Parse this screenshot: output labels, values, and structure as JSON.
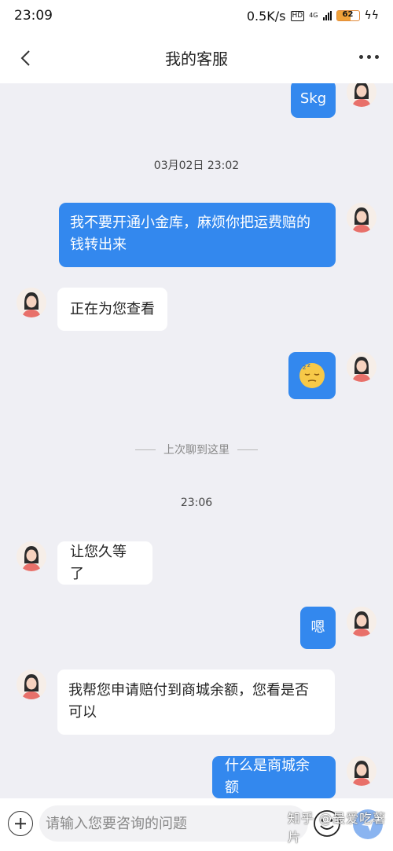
{
  "status": {
    "time": "23:09",
    "speed": "0.5K/s",
    "hd": "HD",
    "network": "4G",
    "battery": "62"
  },
  "header": {
    "title": "我的客服"
  },
  "messages": {
    "m1": "Skg",
    "ts1": "03月02日 23:02",
    "m2_line1": "我不要开通小金库，麻烦你把运费赔的",
    "m2_line2": "钱转出来",
    "m3": "正在为您查看",
    "divider": "上次聊到这里",
    "ts2": "23:06",
    "m5": "让您久等了",
    "m6": "嗯",
    "m7_line1": "我帮您申请赔付到商城余额，您看是否",
    "m7_line2": "可以",
    "m8": "什么是商城余额"
  },
  "input": {
    "placeholder": "请输入您要咨询的问题"
  },
  "watermark": "知乎 @最爱吃薯片",
  "colors": {
    "me_bubble": "#3388ee",
    "them_bubble": "#ffffff",
    "background": "#efeff4"
  }
}
